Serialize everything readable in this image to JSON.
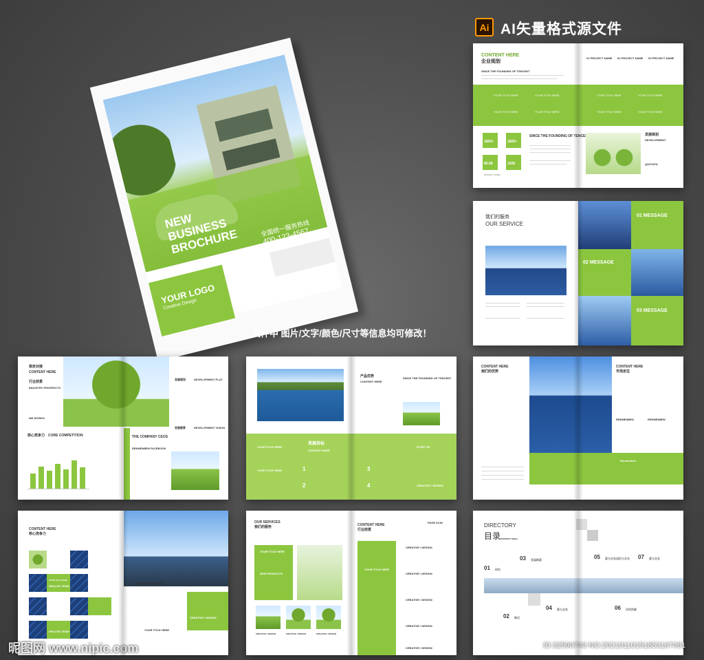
{
  "header": {
    "ai_badge": "Ai",
    "title": "AI矢量格式源文件"
  },
  "notice": "文件中 图片/文字/颜色/尺寸等信息均可修改！",
  "cover": {
    "title_lines": [
      "NEW",
      "BUSINESS",
      "BROCHURE"
    ],
    "hotline_label": "全国统一服务热线",
    "hotline_number": "400-123-4567",
    "logo": "YOUR LOGO",
    "logo_sub": "Creative Design"
  },
  "spread_planning": {
    "heading": "CONTENT HERE",
    "heading_cn": "企业规划",
    "sub": "SINCE THE FOUNDING OF TENCENT",
    "block_title": "SINCE THE FOUNDING OF TENCENT",
    "tile_label": "YOUR TITLE HERE",
    "stats": [
      "1800+",
      "1800+",
      "85.6$",
      "150$"
    ],
    "stat_label": "PROJECT NAME",
    "project_items": [
      "01 PROJECT NAME",
      "02 PROJECT NAME",
      "03 PROJECT NAME"
    ],
    "dev_title_cn": "发展规划",
    "dev_title": "DEVELOPMENT",
    "quotes": "QUOTATA"
  },
  "spread_service": {
    "title_cn": "我们的服务",
    "title": "OUR SERVICE",
    "messages": [
      "01 MESSAGE",
      "02 MESSAGE",
      "03 MESSAGE"
    ]
  },
  "spread_competition": {
    "title_cn": "规定对接",
    "title": "CONTENT HERE",
    "prospects_cn": "行业前景",
    "prospects": "INDUSTRY PROSPECTS",
    "we_work": "WE WORKS",
    "core_cn": "核心竞争力",
    "core": "CORE COMPETITION",
    "dev_cn": "发展规划",
    "dev": "DEVELOPMENT PLAT",
    "company_ceos": "THE COMPANY CEOS",
    "renmenben": "RENMENBEN FACEBOOK",
    "vision_cn": "发展愿景",
    "vision": "DEVELOPMENT VISION",
    "bars": [
      38,
      55,
      44,
      62,
      48,
      70,
      52
    ]
  },
  "spread_product": {
    "title_cn": "产品优势",
    "title": "CONTENT HERE",
    "since": "SINCE THE FOUNDING OF TENCENT",
    "goal_cn": "发展目标",
    "goal": "CONTENT HERE",
    "tile": "YOUR TITLE HERE",
    "numbers": [
      "1",
      "2",
      "3",
      "4"
    ],
    "start_up": "START UP",
    "creative": "CREATIVE / DESIGN"
  },
  "spread_market": {
    "title_left": "CONTENT HERE",
    "title_left_cn": "我们的优势",
    "title_right": "CONTENT HERE",
    "title_right_cn": "市场定位",
    "rb1": "RENMENBEN",
    "rb2": "RENMENBEN",
    "rb3": "Renmenben"
  },
  "spread_team": {
    "title": "CONTENT HERE",
    "title_cn": "核心竞争力",
    "team_label": "YOUR TITLE HERE",
    "team_sub": "SKILLED TEAM",
    "new_products": "NEW PRODUCTS",
    "creative": "CREATIVE / DESIGN",
    "your_title": "YOUR TITLE HERE"
  },
  "spread_services2": {
    "title": "OUR SERVICES",
    "title_cn": "我们的服务",
    "your_title": "YOUR TITLE HERE",
    "new_products": "NEW PRODUCTS",
    "creative": "CREATIVE / DESIGN",
    "content_here": "CONTENT HERE",
    "content_cn": "行业前景",
    "page": "PAGE 01/02",
    "creative_items": [
      "CREATIVE / DESIGN",
      "CREATIVE / DESIGN",
      "CREATIVE / DESIGN",
      "CREATIVE / DESIGN",
      "CREATIVE / DESIGN"
    ]
  },
  "spread_directory": {
    "title": "DIRECTORY",
    "title_cn": "目录",
    "sub": "CONTENTS TABLE",
    "entries": [
      {
        "num": "01",
        "label": "研究"
      },
      {
        "num": "02",
        "label": "概况"
      },
      {
        "num": "03",
        "label": "发展概要"
      },
      {
        "num": "04",
        "label": "要与业务"
      },
      {
        "num": "05",
        "label": "要与业务组织与文化"
      },
      {
        "num": "06",
        "label": "风险防御"
      },
      {
        "num": "07",
        "label": "要与业务"
      }
    ]
  },
  "watermark": {
    "left": "昵图网 www.nipic.com",
    "right": "ID:32590743 NO:20210110151853167081"
  }
}
